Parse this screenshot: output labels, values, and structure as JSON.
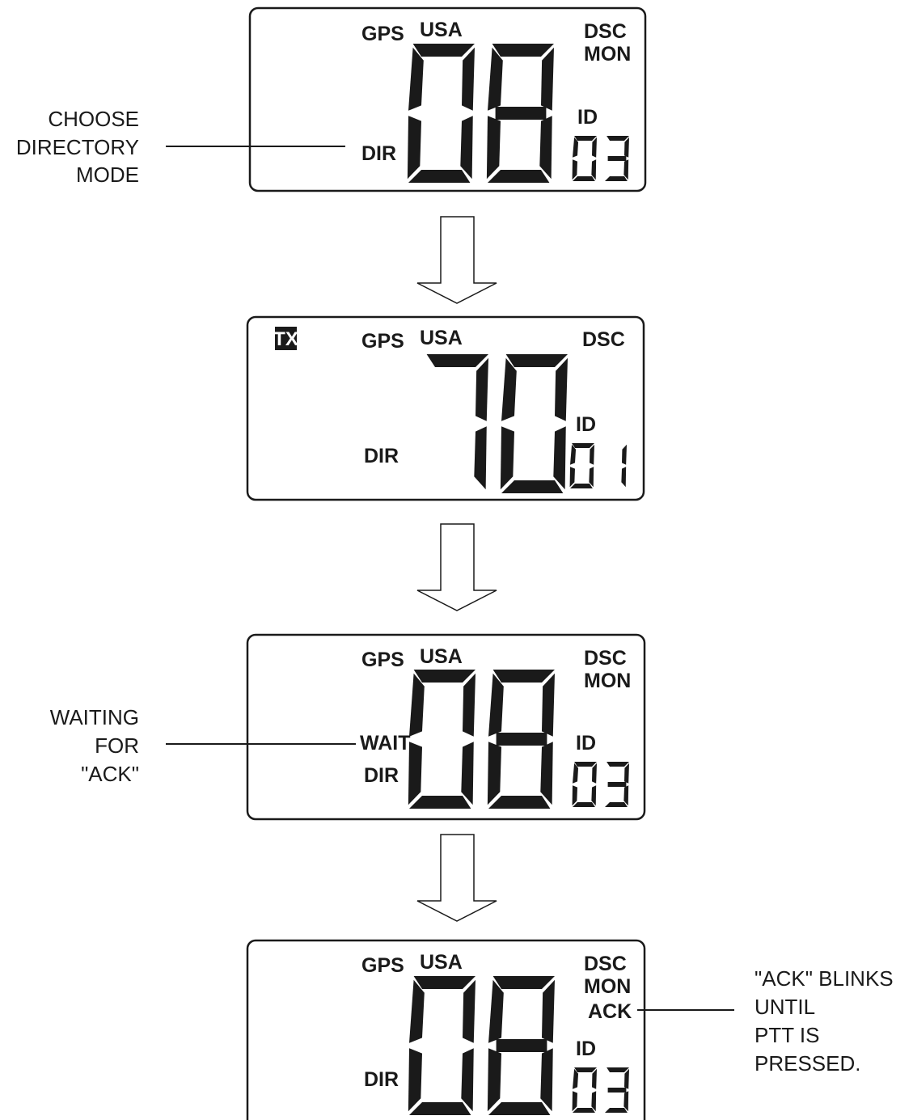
{
  "screens": [
    {
      "gps": "GPS",
      "usa": "USA",
      "dsc": "DSC",
      "mon": "MON",
      "id_label": "ID",
      "dir": "DIR",
      "channel": "08",
      "id_value": "03"
    },
    {
      "tx": "TX",
      "gps": "GPS",
      "usa": "USA",
      "dsc": "DSC",
      "id_label": "ID",
      "dir": "DIR",
      "channel": "70",
      "id_value": "01"
    },
    {
      "gps": "GPS",
      "usa": "USA",
      "dsc": "DSC",
      "mon": "MON",
      "id_label": "ID",
      "wait": "WAIT",
      "dir": "DIR",
      "channel": "08",
      "id_value": "03"
    },
    {
      "gps": "GPS",
      "usa": "USA",
      "dsc": "DSC",
      "mon": "MON",
      "ack": "ACK",
      "id_label": "ID",
      "dir": "DIR",
      "channel": "08",
      "id_value": "03"
    }
  ],
  "callouts": {
    "choose": [
      "CHOOSE",
      "DIRECTORY",
      "MODE"
    ],
    "waiting": [
      "WAITING",
      "FOR",
      "\"ACK\""
    ],
    "ack": [
      "\"ACK\" BLINKS",
      "UNTIL",
      "PTT IS",
      "PRESSED."
    ]
  },
  "colors": {
    "ink": "#1a1a1a",
    "background": "#ffffff"
  }
}
